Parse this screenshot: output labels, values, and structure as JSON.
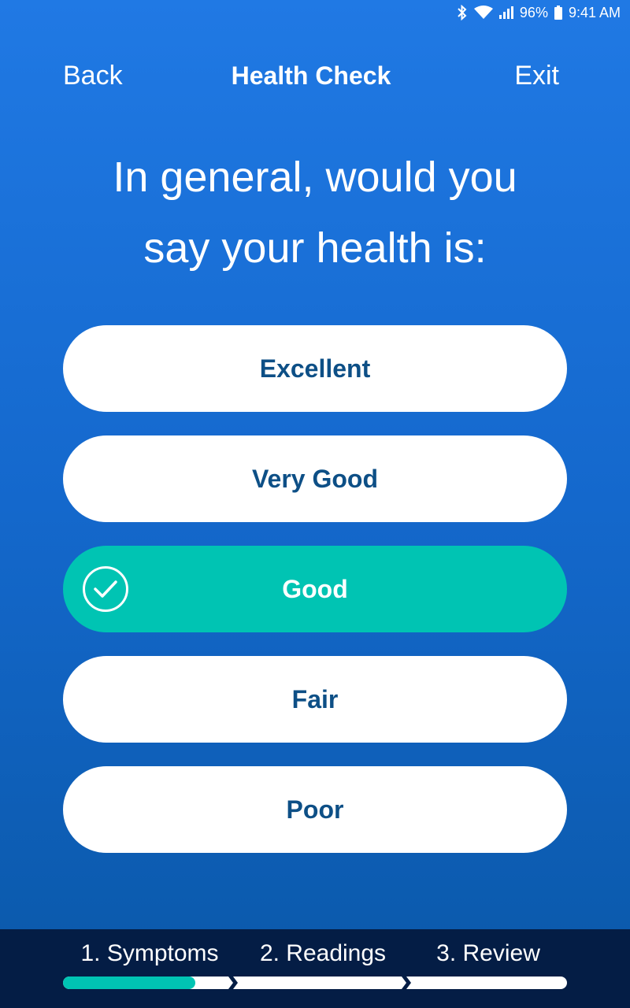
{
  "status": {
    "battery": "96%",
    "time": "9:41 AM",
    "icons": [
      "bluetooth-icon",
      "wifi-icon",
      "signal-icon",
      "battery-icon"
    ]
  },
  "nav": {
    "back": "Back",
    "title": "Health Check",
    "exit": "Exit"
  },
  "question": {
    "line1": "In general, would you",
    "line2": "say your health is:"
  },
  "options": [
    {
      "label": "Excellent",
      "selected": false
    },
    {
      "label": "Very Good",
      "selected": false
    },
    {
      "label": "Good",
      "selected": true
    },
    {
      "label": "Fair",
      "selected": false
    },
    {
      "label": "Poor",
      "selected": false
    }
  ],
  "steps": [
    {
      "label": "1. Symptoms",
      "progress": 0.8
    },
    {
      "label": "2. Readings",
      "progress": 0
    },
    {
      "label": "3. Review",
      "progress": 0
    }
  ],
  "colors": {
    "accent": "#00c4b3",
    "option_text": "#0d4f86",
    "footer": "#041d45"
  }
}
